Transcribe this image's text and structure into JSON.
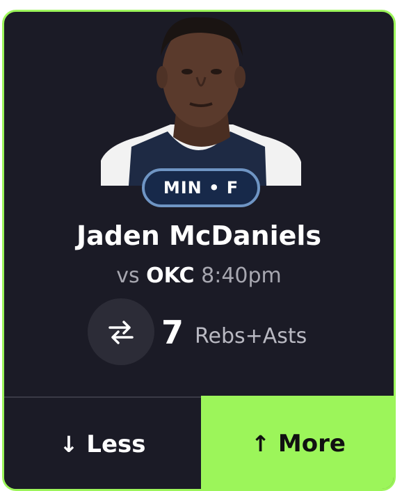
{
  "card": {
    "badge": "MIN • F",
    "player_name": "Jaden McDaniels",
    "matchup_prefix": "vs",
    "opponent": "OKC",
    "game_time": "8:40pm",
    "line_value": "7",
    "stat_type": "Rebs+Asts",
    "swap_icon": "swap-arrows-icon",
    "less_arrow": "↓",
    "less_label": "Less",
    "more_arrow": "↑",
    "more_label": "More"
  },
  "colors": {
    "accent": "#9cf55a",
    "card_bg": "#1b1b26",
    "badge_bg": "#17294a",
    "badge_border": "#6f95c4"
  }
}
